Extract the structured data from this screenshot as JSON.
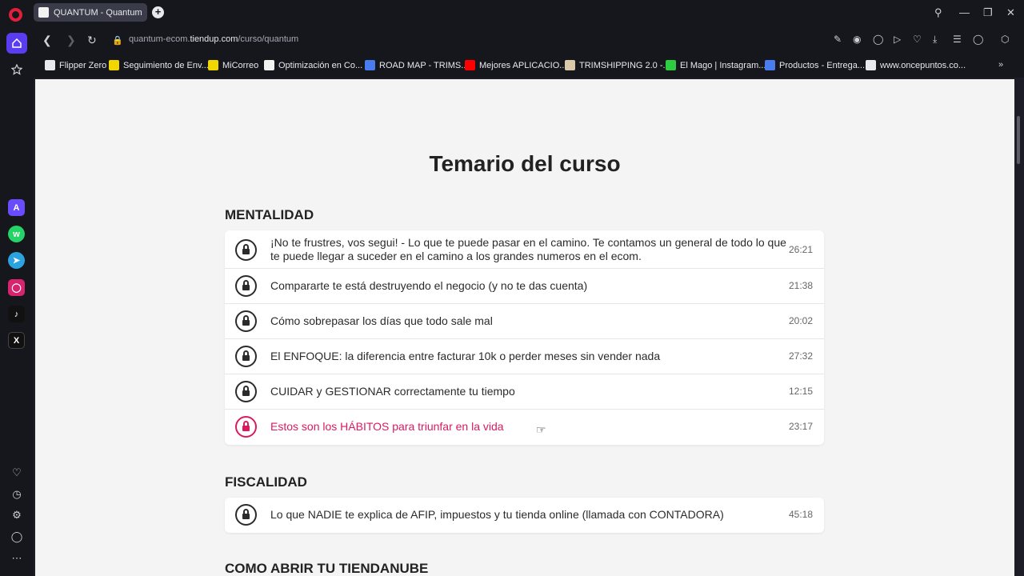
{
  "browser": {
    "tab_title": "QUANTUM - Quantum Ec",
    "new_tab": "+",
    "url_prefix": "quantum-ecom.",
    "url_domain": "tiendup.com",
    "url_path": "/curso/quantum"
  },
  "bookmarks": [
    {
      "label": "Flipper Zero",
      "color": "#e8e8ee"
    },
    {
      "label": "Seguimiento de Env...",
      "color": "#f2d600"
    },
    {
      "label": "MiCorreo",
      "color": "#f2d600"
    },
    {
      "label": "Optimización en Co...",
      "color": "#f2f2f2"
    },
    {
      "label": "ROAD MAP - TRIMS...",
      "color": "#4a7cf0"
    },
    {
      "label": "Mejores APLICACIO...",
      "color": "#ff0000"
    },
    {
      "label": "TRIMSHIPPING 2.0 -...",
      "color": "#d9c9a8"
    },
    {
      "label": "El Mago | Instagram...",
      "color": "#2ecc40"
    },
    {
      "label": "Productos - Entrega...",
      "color": "#4a7cf0"
    },
    {
      "label": "www.oncepuntos.co...",
      "color": "#e8e8ee"
    }
  ],
  "page": {
    "heading": "Temario del curso",
    "sections": [
      {
        "title": "MENTALIDAD",
        "lessons": [
          {
            "title": "¡No te frustres, vos segui! - Lo que te puede pasar en el camino. Te contamos un general de todo lo que te puede llegar a suceder en el camino a los grandes numeros en el ecom.",
            "time": "26:21"
          },
          {
            "title": "Compararte te está destruyendo el negocio (y no te das cuenta)",
            "time": "21:38"
          },
          {
            "title": "Cómo sobrepasar los días que todo sale mal",
            "time": "20:02"
          },
          {
            "title": "El ENFOQUE: la diferencia entre facturar 10k o perder meses sin vender nada",
            "time": "27:32"
          },
          {
            "title": "CUIDAR y GESTIONAR correctamente tu tiempo",
            "time": "12:15"
          },
          {
            "title": "Estos son los HÁBITOS para triunfar en la vida",
            "time": "23:17"
          }
        ]
      },
      {
        "title": "FISCALIDAD",
        "lessons": [
          {
            "title": "Lo que NADIE te explica de AFIP, impuestos y tu tienda online (llamada con CONTADORA)",
            "time": "45:18"
          }
        ]
      },
      {
        "title": "COMO ABRIR TU TIENDANUBE",
        "lessons": []
      }
    ]
  },
  "colors": {
    "accent": "#d81b60",
    "opera_red": "#e0203a",
    "sidebar_active": "#5a3df0"
  }
}
